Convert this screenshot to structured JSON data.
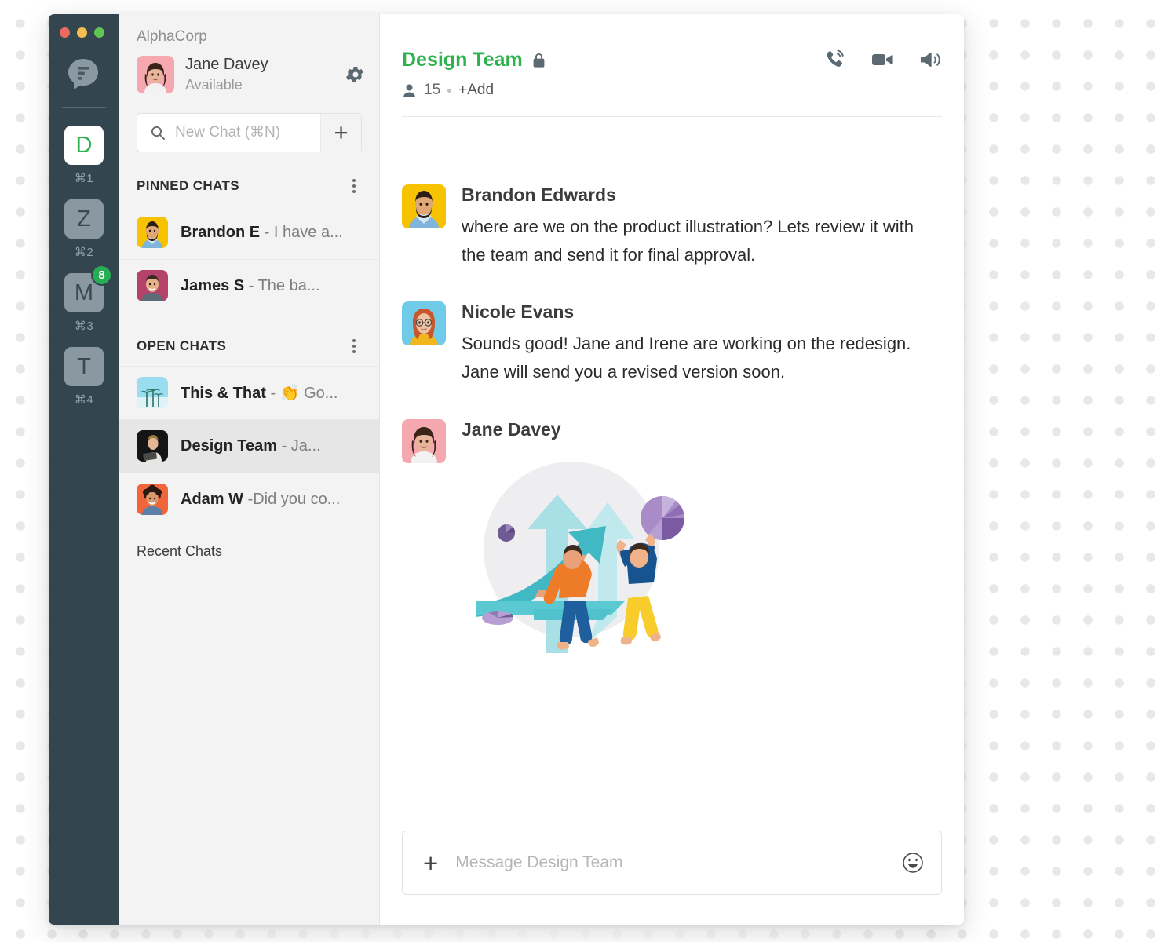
{
  "window": {
    "traffic_lights": [
      "close",
      "minimize",
      "maximize"
    ]
  },
  "rail": {
    "logo_name": "flock-chat-bubble-logo",
    "items": [
      {
        "letter": "D",
        "shortcut": "⌘1",
        "active": true,
        "badge": ""
      },
      {
        "letter": "Z",
        "shortcut": "⌘2",
        "active": false,
        "badge": ""
      },
      {
        "letter": "M",
        "shortcut": "⌘3",
        "active": false,
        "badge": "8"
      },
      {
        "letter": "T",
        "shortcut": "⌘4",
        "active": false,
        "badge": ""
      }
    ]
  },
  "sidebar": {
    "org": "AlphaCorp",
    "me": {
      "name": "Jane Davey",
      "status": "Available",
      "avatar_bg": "#f5a8b0"
    },
    "search": {
      "placeholder": "New Chat (⌘N)",
      "value": "",
      "add_label": "+"
    },
    "pinned": {
      "title": "PINNED CHATS",
      "rows": [
        {
          "name": "Brandon E",
          "preview": "- I have a...",
          "avatar_bg": "#f7c300"
        },
        {
          "name": "James S",
          "preview": "- The ba...",
          "avatar_bg": "#b5426a"
        }
      ]
    },
    "open": {
      "title": "OPEN CHATS",
      "rows": [
        {
          "name": "This & That",
          "preview": "- 👏 Go...",
          "avatar_bg": "#9adcf0",
          "selected": false
        },
        {
          "name": "Design Team",
          "preview": "- Ja...",
          "avatar_bg": "#1b1b1b",
          "selected": true
        },
        {
          "name": "Adam W",
          "preview": "-Did you co...",
          "avatar_bg": "#f0653a",
          "selected": false
        }
      ]
    },
    "recent_chats": "Recent Chats"
  },
  "chat": {
    "title": "Design Team",
    "title_color": "#2eb24e",
    "lock_icon": "lock-icon",
    "member_count": "15",
    "add_label": "+Add",
    "actions": [
      "phone-call-icon",
      "video-camera-icon",
      "speaker-icon"
    ],
    "messages": [
      {
        "author": "Brandon Edwards",
        "text": "where are we on the product illustration? Lets review it with the team and send it for final approval.",
        "avatar_bg": "#f7c300",
        "has_image": false
      },
      {
        "author": "Nicole Evans",
        "text": "Sounds good! Jane and Irene are working on the redesign. Jane will send you a revised version soon.",
        "avatar_bg": "#6fcbe8",
        "has_image": false
      },
      {
        "author": "Jane Davey",
        "text": "",
        "avatar_bg": "#f5a8b0",
        "has_image": true,
        "image_alt": "teamwork-growth-chart-illustration"
      }
    ],
    "composer": {
      "placeholder": "Message Design Team",
      "value": "",
      "plus_label": "+",
      "emoji_icon": "smiley-face-icon"
    }
  }
}
